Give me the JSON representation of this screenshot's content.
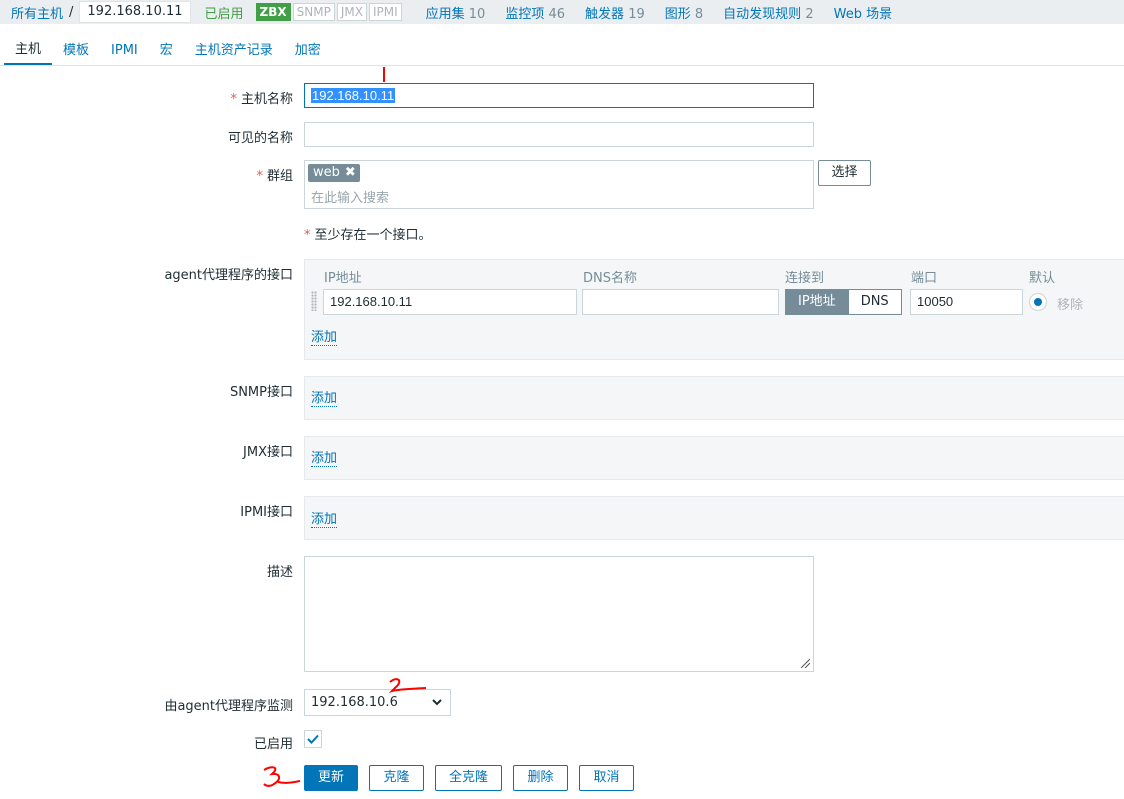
{
  "breadcrumb": {
    "all_hosts": "所有主机",
    "separator": "/",
    "current": "192.168.10.11",
    "status": "已启用",
    "availability": [
      "ZBX",
      "SNMP",
      "JMX",
      "IPMI"
    ],
    "links": [
      {
        "label": "应用集",
        "count": "10"
      },
      {
        "label": "监控项",
        "count": "46"
      },
      {
        "label": "触发器",
        "count": "19"
      },
      {
        "label": "图形",
        "count": "8"
      },
      {
        "label": "自动发现规则",
        "count": "2"
      },
      {
        "label": "Web 场景",
        "count": ""
      }
    ]
  },
  "tabs": [
    "主机",
    "模板",
    "IPMI",
    "宏",
    "主机资产记录",
    "加密"
  ],
  "form": {
    "hostname_label": "主机名称",
    "hostname_value": "192.168.10.11",
    "visible_name_label": "可见的名称",
    "visible_name_value": "",
    "groups_label": "群组",
    "group_chip": "web",
    "group_chip_remove": "✖",
    "group_placeholder": "在此输入搜索",
    "select_button": "选择",
    "required_marker": "*",
    "interface_note": "至少存在一个接口。",
    "agent_label": "agent代理程序的接口",
    "agent_headers": {
      "ip": "IP地址",
      "dns": "DNS名称",
      "connect": "连接到",
      "port": "端口",
      "default": "默认"
    },
    "agent_ip": "192.168.10.11",
    "agent_dns": "",
    "connect_ip": "IP地址",
    "connect_dns": "DNS",
    "agent_port": "10050",
    "remove": "移除",
    "add": "添加",
    "snmp_label": "SNMP接口",
    "jmx_label": "JMX接口",
    "ipmi_label": "IPMI接口",
    "description_label": "描述",
    "description_value": "",
    "proxy_label": "由agent代理程序监测",
    "proxy_value": "192.168.10.6",
    "enabled_label": "已启用",
    "enabled_checked": true
  },
  "buttons": {
    "update": "更新",
    "clone": "克隆",
    "full_clone": "全克隆",
    "delete": "删除",
    "cancel": "取消"
  },
  "annotations": [
    "1",
    "2",
    "3"
  ],
  "colors": {
    "accent": "#0275b8",
    "enabled_green": "#429e47",
    "required_red": "#e45959",
    "annotation_red": "#ff0000"
  }
}
